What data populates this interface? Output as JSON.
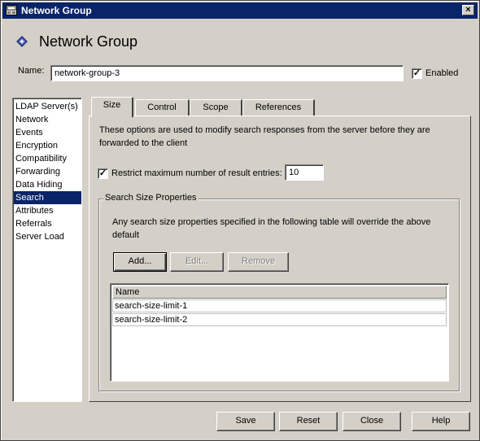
{
  "window": {
    "title": "Network Group",
    "close_glyph": "×"
  },
  "header": {
    "title": "Network Group",
    "icon": "diamond-icon"
  },
  "name_field": {
    "label": "Name:",
    "value": "network-group-3"
  },
  "enabled": {
    "label": "Enabled",
    "checked": true,
    "check_glyph": "✓"
  },
  "nav": {
    "items": [
      "LDAP Server(s)",
      "Network",
      "Events",
      "Encryption",
      "Compatibility",
      "Forwarding",
      "Data Hiding",
      "Search",
      "Attributes",
      "Referrals",
      "Server Load"
    ],
    "selected": "Search"
  },
  "tabs": [
    "Size",
    "Control",
    "Scope",
    "References"
  ],
  "active_tab": "Size",
  "size_tab": {
    "description_line1": "These options are used to modify search responses from the server before they are",
    "description_line2": "forwarded to the client",
    "restrict": {
      "label": "Restrict maximum number of result entries:",
      "checked": true,
      "check_glyph": "✓",
      "value": "10"
    },
    "group": {
      "legend": "Search Size Properties",
      "note_line1": "Any search size properties specified in the following table will override the above",
      "note_line2": "default",
      "buttons": {
        "add": "Add...",
        "edit": "Edit...",
        "remove": "Remove"
      },
      "table": {
        "header": "Name",
        "rows": [
          "search-size-limit-1",
          "search-size-limit-2"
        ]
      }
    }
  },
  "footer": {
    "save": "Save",
    "reset": "Reset",
    "close": "Close",
    "help": "Help"
  },
  "colors": {
    "face": "#d4d0c8",
    "title_bar": "#0a246a",
    "selection": "#0a246a",
    "header_icon": "#2f3a8c"
  }
}
